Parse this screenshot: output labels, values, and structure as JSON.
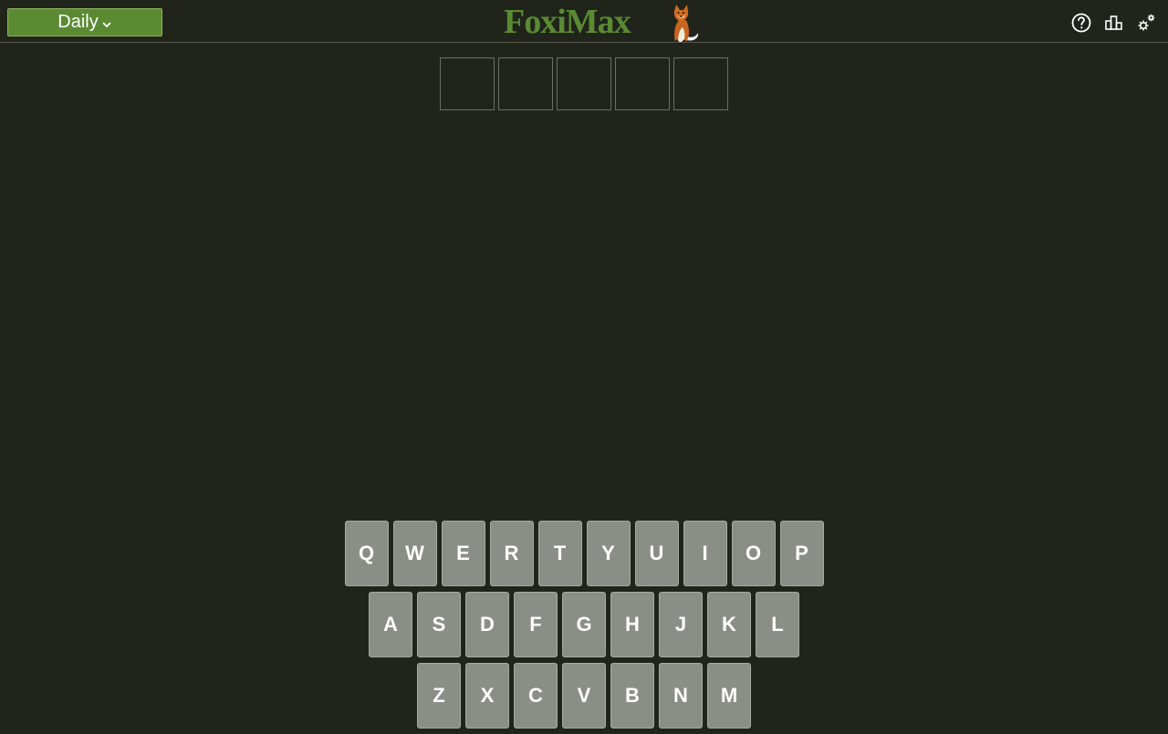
{
  "header": {
    "mode_label": "Daily",
    "logo_text": "FoxiMax",
    "icons": [
      "help-icon",
      "stats-icon",
      "settings-icon"
    ]
  },
  "board": {
    "tiles": [
      "",
      "",
      "",
      "",
      ""
    ]
  },
  "keyboard": {
    "rows": [
      [
        "Q",
        "W",
        "E",
        "R",
        "T",
        "Y",
        "U",
        "I",
        "O",
        "P"
      ],
      [
        "A",
        "S",
        "D",
        "F",
        "G",
        "H",
        "J",
        "K",
        "L"
      ],
      [
        "Z",
        "X",
        "C",
        "V",
        "B",
        "N",
        "M"
      ]
    ]
  },
  "colors": {
    "background": "#20241b",
    "accent": "#5a8a32",
    "key": "#8b8e86",
    "tile_border": "#6b6e66"
  }
}
